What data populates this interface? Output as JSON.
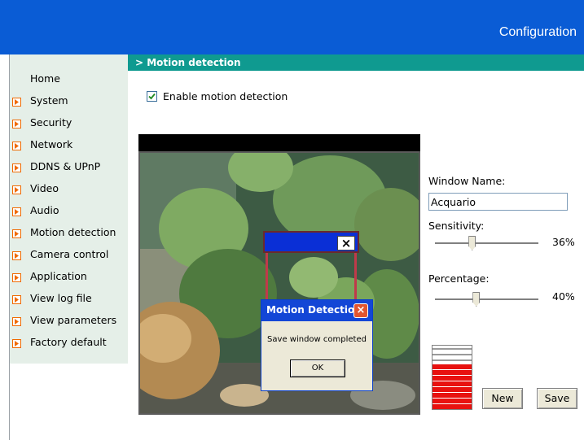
{
  "header": {
    "title": "Configuration"
  },
  "sidebar": {
    "items": [
      {
        "label": "Home",
        "icon": "none"
      },
      {
        "label": "System",
        "icon": "arrow-icon"
      },
      {
        "label": "Security",
        "icon": "arrow-icon"
      },
      {
        "label": "Network",
        "icon": "arrow-icon"
      },
      {
        "label": "DDNS & UPnP",
        "icon": "arrow-icon"
      },
      {
        "label": "Video",
        "icon": "arrow-icon"
      },
      {
        "label": "Audio",
        "icon": "arrow-icon"
      },
      {
        "label": "Motion detection",
        "icon": "arrow-icon"
      },
      {
        "label": "Camera control",
        "icon": "arrow-icon"
      },
      {
        "label": "Application",
        "icon": "arrow-icon"
      },
      {
        "label": "View log file",
        "icon": "arrow-icon"
      },
      {
        "label": "View parameters",
        "icon": "arrow-icon"
      },
      {
        "label": "Factory default",
        "icon": "arrow-icon"
      }
    ]
  },
  "section": {
    "title": "> Motion detection"
  },
  "enable": {
    "label": "Enable motion detection",
    "checked": true
  },
  "motion_window": {
    "close_glyph": "×"
  },
  "dialog": {
    "title": "Motion Detection",
    "message": "Save window completed",
    "ok_label": "OK",
    "close_glyph": "×"
  },
  "settings": {
    "window_name_label": "Window Name:",
    "window_name_value": "Acquario",
    "sensitivity_label": "Sensitivity:",
    "sensitivity_value": "36%",
    "sensitivity_level": 0.36,
    "percentage_label": "Percentage:",
    "percentage_value": "40%",
    "percentage_level": 0.4
  },
  "buttons": {
    "new_label": "New",
    "save_label": "Save"
  },
  "colors": {
    "header_blue": "#0a5cd5",
    "section_teal": "#0f9a90",
    "sidebar_bg": "#e5efe8",
    "level_red": "#e8110f",
    "dialog_title_blue": "#1346d6",
    "arrow_orange": "#f06a00"
  }
}
